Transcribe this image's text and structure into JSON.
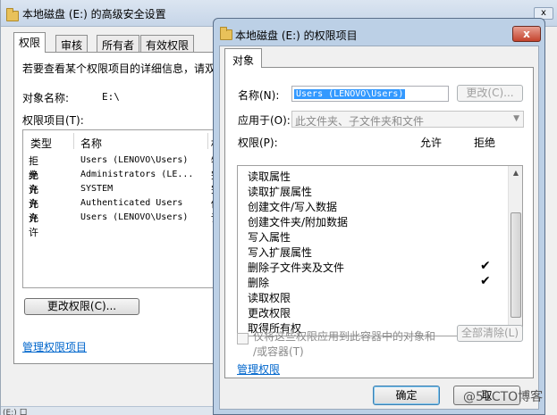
{
  "bg_window": {
    "title": "本地磁盘 (E:) 的高级安全设置",
    "close_label": "x",
    "tabs": [
      "权限",
      "审核",
      "所有者",
      "有效权限"
    ],
    "info_text": "若要查看某个权限项目的详细信息，请双",
    "object_name_label": "对象名称:",
    "object_name_value": "E:\\",
    "entries_label": "权限项目(T):",
    "columns": [
      "类型",
      "名称",
      "权"
    ],
    "rows": [
      {
        "type": "拒绝",
        "name": "Users (LENOVO\\Users)",
        "perm": "特"
      },
      {
        "type": "允许",
        "name": "Administrators (LE...",
        "perm": "完"
      },
      {
        "type": "允许",
        "name": "SYSTEM",
        "perm": "完"
      },
      {
        "type": "允许",
        "name": "Authenticated Users",
        "perm": "修"
      },
      {
        "type": "允许",
        "name": "Users (LENOVO\\Users)",
        "perm": "读"
      }
    ],
    "change_button": "更改权限(C)...",
    "manage_link": "管理权限项目",
    "taskbar_fragment": "(E:) 口"
  },
  "dialog": {
    "title": "本地磁盘 (E:) 的权限项目",
    "close_label": "x",
    "tab": "对象",
    "name_label": "名称(N):",
    "name_value": "Users (LENOVO\\Users)",
    "change_button": "更改(C)...",
    "apply_to_label": "应用于(O):",
    "apply_to_value": "此文件夹、子文件夹和文件",
    "perm_label": "权限(P):",
    "allow_header": "允许",
    "deny_header": "拒绝",
    "permissions": [
      {
        "label": "读取属性",
        "deny": false
      },
      {
        "label": "读取扩展属性",
        "deny": false
      },
      {
        "label": "创建文件/写入数据",
        "deny": false
      },
      {
        "label": "创建文件夹/附加数据",
        "deny": false
      },
      {
        "label": "写入属性",
        "deny": false
      },
      {
        "label": "写入扩展属性",
        "deny": false
      },
      {
        "label": "删除子文件夹及文件",
        "deny": true
      },
      {
        "label": "删除",
        "deny": true
      },
      {
        "label": "读取权限",
        "deny": false
      },
      {
        "label": "更改权限",
        "deny": false
      },
      {
        "label": "取得所有权",
        "deny": false
      }
    ],
    "apply_only_line1": "仅将这些权限应用到此容器中的对象和",
    "apply_only_line2": "/或容器(T)",
    "clear_all_button": "全部清除(L)",
    "manage_link": "管理权限",
    "ok_button": "确定",
    "cancel_fragment": "取"
  },
  "watermark": "@51CTO博客"
}
